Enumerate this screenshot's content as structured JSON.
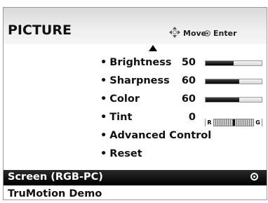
{
  "menu": {
    "title": "PICTURE",
    "hints": {
      "move_label": "Move",
      "enter_label": "Enter"
    }
  },
  "picture_items": [
    {
      "label": "Brightness",
      "value": "50",
      "level": 50
    },
    {
      "label": "Sharpness",
      "value": "60",
      "level": 60
    },
    {
      "label": "Color",
      "value": "60",
      "level": 60
    },
    {
      "label": "Tint",
      "value": "0",
      "tint_left": "R",
      "tint_right": "G"
    },
    {
      "label": "Advanced Control"
    },
    {
      "label": "Reset"
    }
  ],
  "bullet": "•",
  "rows": {
    "screen": {
      "label": "Screen (RGB-PC)",
      "selected": true
    },
    "trumotion": {
      "label": "TruMotion Demo"
    }
  }
}
